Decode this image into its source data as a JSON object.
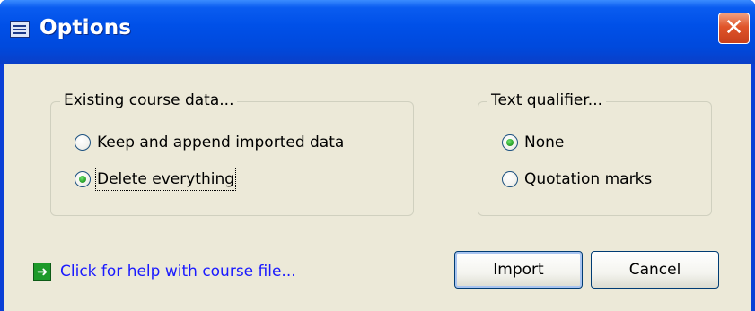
{
  "window": {
    "title": "Options"
  },
  "groups": {
    "course_data": {
      "label": "Existing course data...",
      "options": [
        {
          "label": "Keep and append imported data",
          "checked": false
        },
        {
          "label": "Delete everything",
          "checked": true
        }
      ]
    },
    "text_qualifier": {
      "label": "Text qualifier...",
      "options": [
        {
          "label": "None",
          "checked": true
        },
        {
          "label": "Quotation marks",
          "checked": false
        }
      ]
    }
  },
  "help_link": {
    "label": "Click for help with course file...",
    "icon": "green-arrow-icon"
  },
  "buttons": {
    "import": "Import",
    "cancel": "Cancel"
  },
  "colors": {
    "titlebar": "#0050e8",
    "client": "#ece9d8",
    "link": "#1a1aff",
    "close": "#e0552a"
  }
}
